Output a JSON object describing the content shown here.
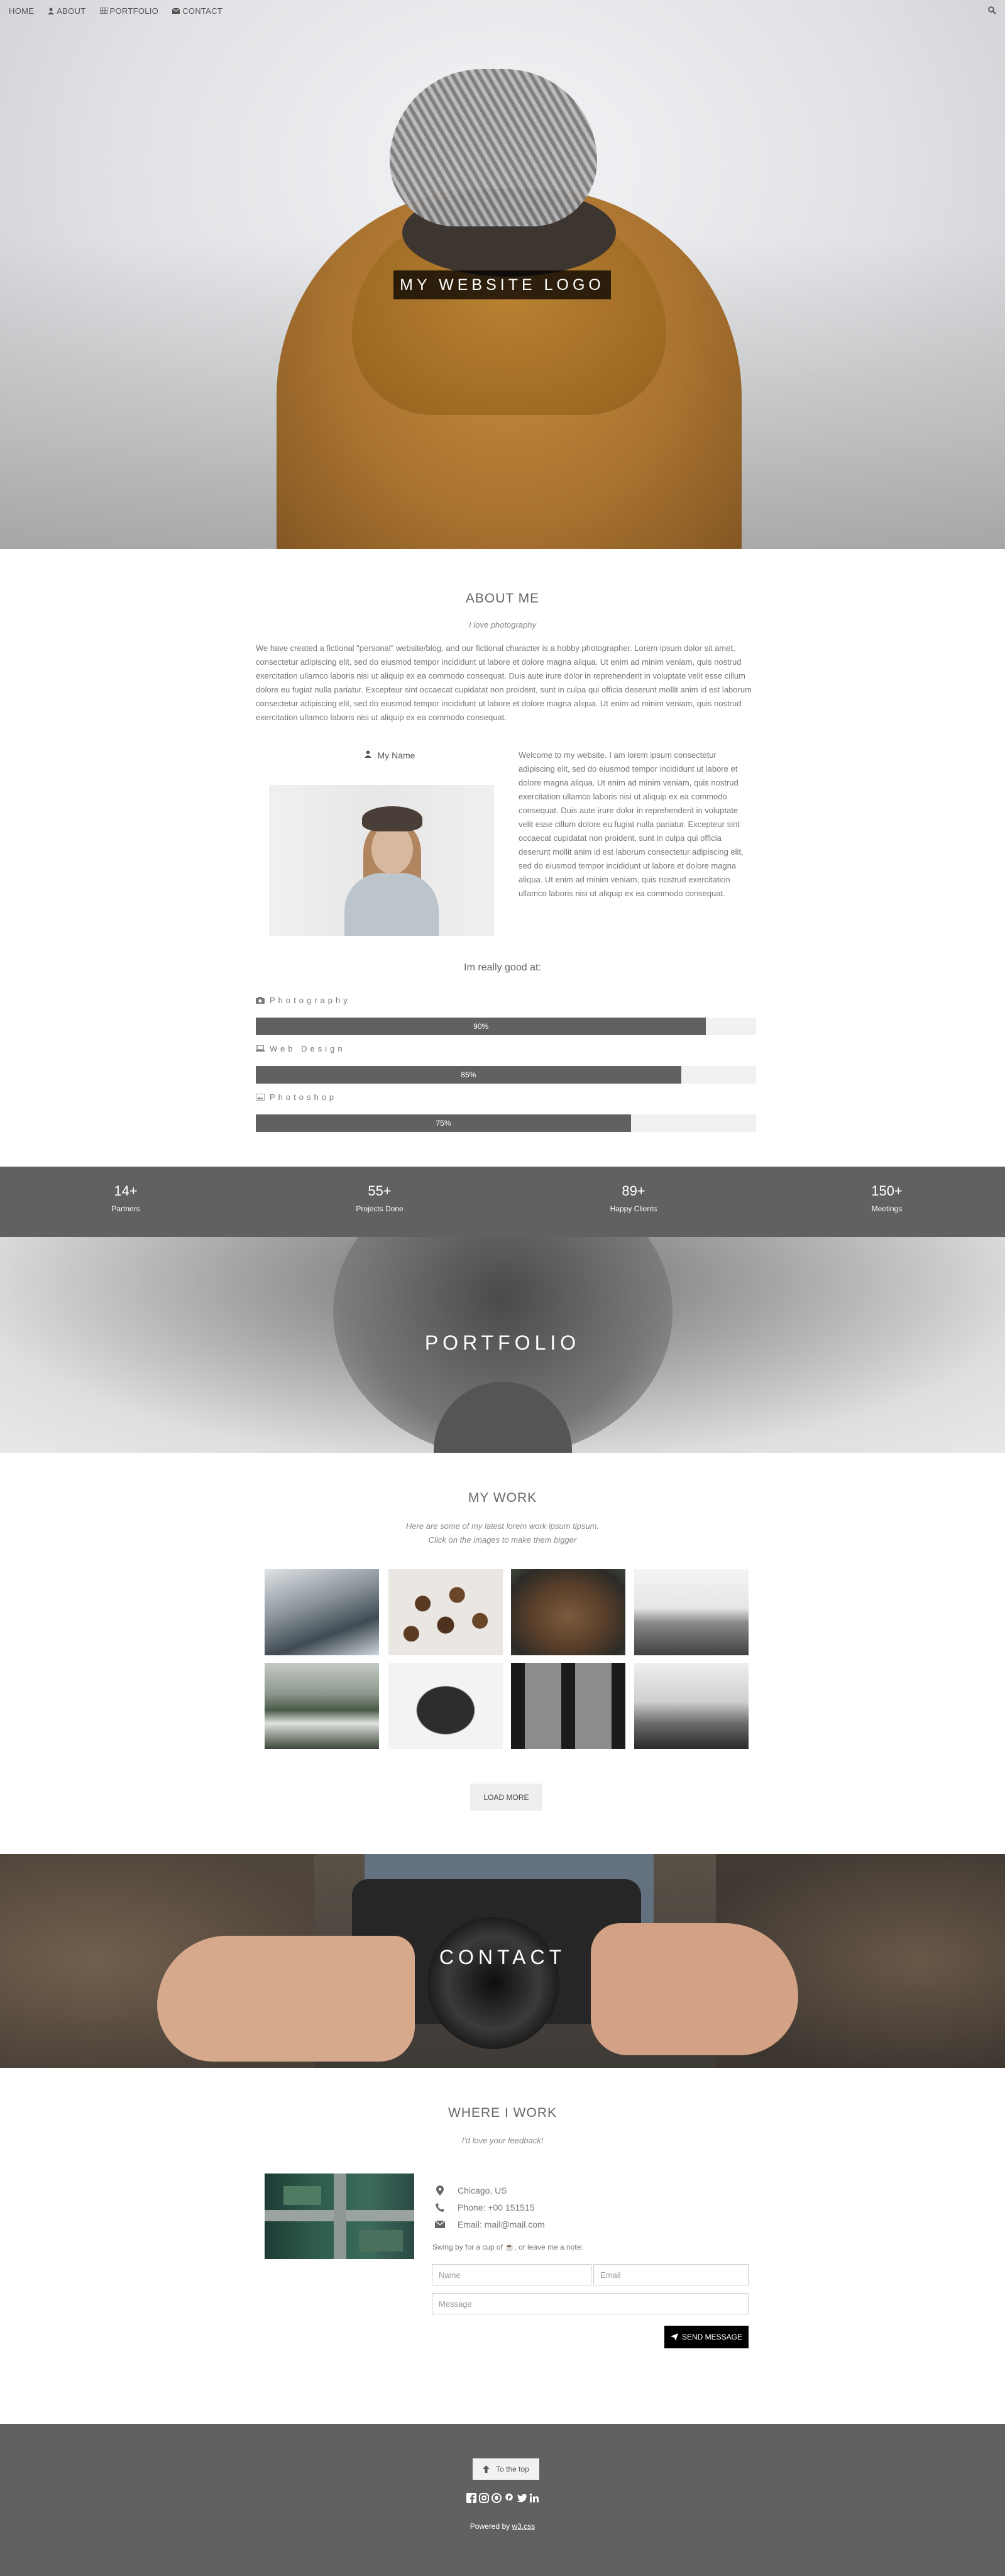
{
  "nav": {
    "items": [
      {
        "label": "HOME",
        "icon": "none"
      },
      {
        "label": "ABOUT",
        "icon": "user-icon"
      },
      {
        "label": "PORTFOLIO",
        "icon": "th-icon"
      },
      {
        "label": "CONTACT",
        "icon": "envelope-icon"
      }
    ],
    "search_icon": "search-icon"
  },
  "hero": {
    "logo": "MY WEBSITE LOGO"
  },
  "about": {
    "title": "ABOUT ME",
    "subtitle": "I love photography",
    "text": "We have created a fictional \"personal\" website/blog, and our fictional character is a hobby photographer. Lorem ipsum dolor sit amet, consectetur adipiscing elit, sed do eiusmod tempor incididunt ut labore et dolore magna aliqua. Ut enim ad minim veniam, quis nostrud exercitation ullamco laboris nisi ut aliquip ex ea commodo consequat. Duis aute irure dolor in reprehenderit in voluptate velit esse cillum dolore eu fugiat nulla pariatur. Excepteur sint occaecat cupidatat non proident, sunt in culpa qui officia deserunt mollit anim id est laborum consectetur adipiscing elit, sed do eiusmod tempor incididunt ut labore et dolore magna aliqua. Ut enim ad minim veniam, quis nostrud exercitation ullamco laboris nisi ut aliquip ex ea commodo consequat.",
    "name": "My Name",
    "welcome": "Welcome to my website. I am lorem ipsum consectetur adipiscing elit, sed do eiusmod tempor incididunt ut labore et dolore magna aliqua. Ut enim ad minim veniam, quis nostrud exercitation ullamco laboris nisi ut aliquip ex ea commodo consequat. Duis aute irure dolor in reprehenderit in voluptate velit esse cillum dolore eu fugiat nulla pariatur. Excepteur sint occaecat cupidatat non proident, sunt in culpa qui officia deserunt mollit anim id est laborum consectetur adipiscing elit, sed do eiusmod tempor incididunt ut labore et dolore magna aliqua. Ut enim ad minim veniam, quis nostrud exercitation ullamco laboris nisi ut aliquip ex ea commodo consequat.",
    "good_at": "Im really good at:",
    "skills": [
      {
        "name": "Photography",
        "icon": "camera-icon",
        "percent": 90,
        "label": "90%"
      },
      {
        "name": "Web Design",
        "icon": "laptop-icon",
        "percent": 85,
        "label": "85%"
      },
      {
        "name": "Photoshop",
        "icon": "image-icon",
        "percent": 75,
        "label": "75%"
      }
    ]
  },
  "stats": [
    {
      "num": "14+",
      "label": "Partners"
    },
    {
      "num": "55+",
      "label": "Projects Done"
    },
    {
      "num": "89+",
      "label": "Happy Clients"
    },
    {
      "num": "150+",
      "label": "Meetings"
    }
  ],
  "portfolio": {
    "banner": "PORTFOLIO",
    "title": "MY WORK",
    "sub1": "Here are some of my latest lorem work ipsum tipsum.",
    "sub2": "Click on the images to make them bigger",
    "load_more": "LOAD MORE",
    "images": [
      "mountains",
      "coffee beans",
      "bear",
      "ocean horizon",
      "misty forest",
      "typewriter",
      "train window",
      "lake"
    ]
  },
  "contact": {
    "banner": "CONTACT",
    "title": "WHERE I WORK",
    "subtitle": "I'd love your feedback!",
    "location": "Chicago, US",
    "phone": "Phone: +00 151515",
    "email": "Email: mail@mail.com",
    "note": "Swing by for a cup of ☕, or leave me a note:",
    "name_placeholder": "Name",
    "email_placeholder": "Email",
    "message_placeholder": "Message",
    "send": "SEND MESSAGE"
  },
  "footer": {
    "to_top": "To the top",
    "socials": [
      "facebook-icon",
      "instagram-icon",
      "snapchat-icon",
      "pinterest-icon",
      "twitter-icon",
      "linkedin-icon"
    ],
    "powered_prefix": "Powered by ",
    "powered_link": "w3.css"
  },
  "colors": {
    "dark_band": "#616161",
    "black_button": "#000000"
  }
}
